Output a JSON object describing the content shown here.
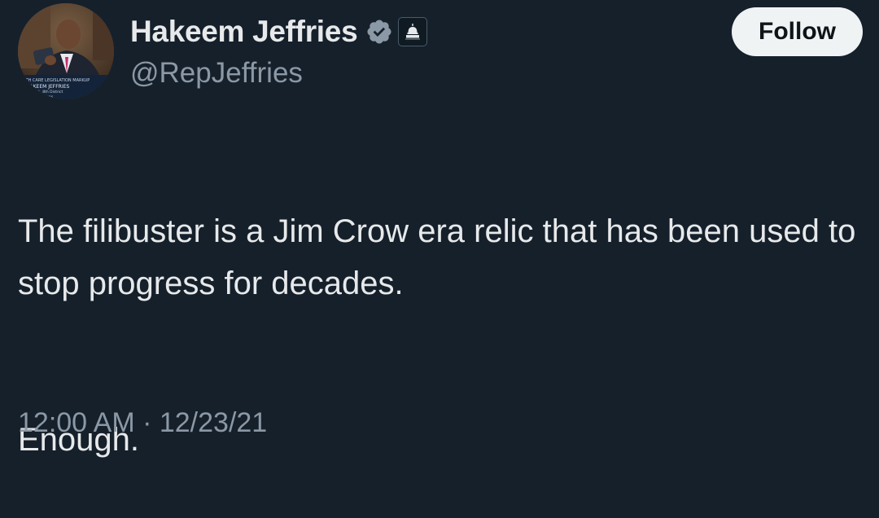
{
  "author": {
    "display_name": "Hakeem Jeffries",
    "handle": "@RepJeffries",
    "verified_icon": "verified-badge-icon",
    "affiliation_icon": "capitol-dome-icon",
    "avatar_caption_lines": [
      "ALTH CARE LEGISLATION MARKUP",
      "HAKEEM JEFFRIES",
      "York, 8th District",
      "Queens"
    ]
  },
  "actions": {
    "follow_label": "Follow"
  },
  "tweet": {
    "paragraph_1": "The filibuster is a Jim Crow era relic that has been used to stop progress for decades.",
    "paragraph_2": "Enough.",
    "timestamp": "12:00 AM · 12/23/21"
  },
  "colors": {
    "background": "#15202b",
    "primary_text": "#e7e9ea",
    "secondary_text": "#8b98a5",
    "follow_button_bg": "#eff3f4",
    "verified_badge": "#8b98a5"
  }
}
